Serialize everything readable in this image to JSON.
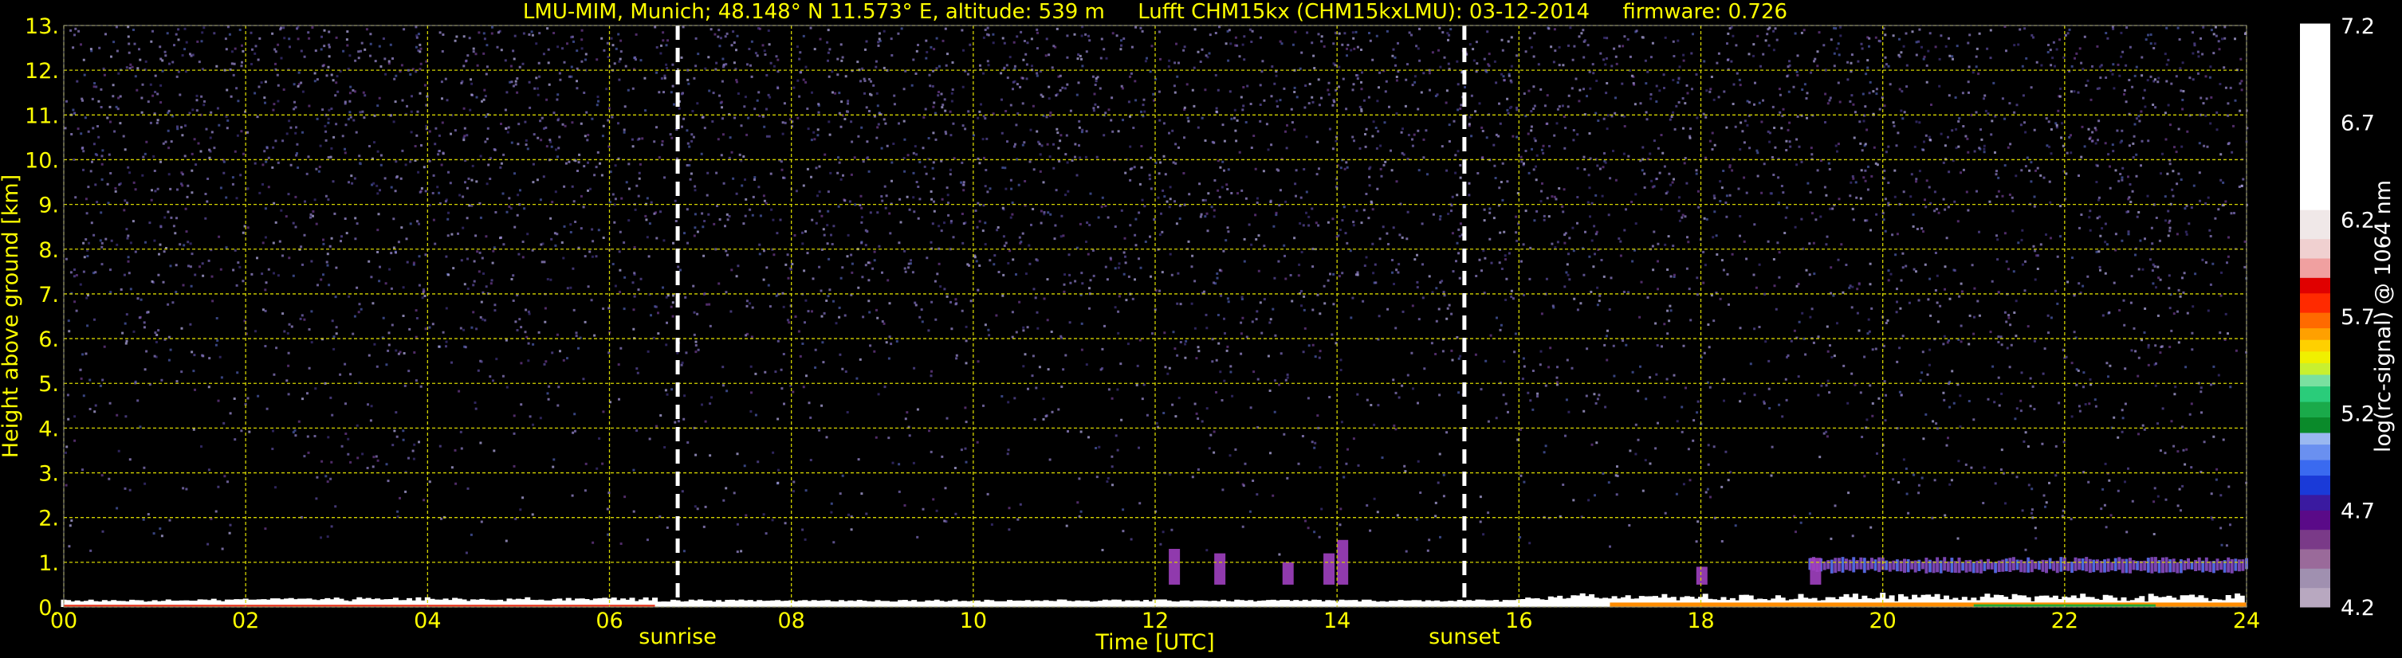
{
  "chart_data": {
    "type": "heatmap",
    "title": "LMU-MIM, Munich; 48.148° N 11.573° E, altitude: 539 m     Lufft CHM15kx (CHM15kxLMU): 03-12-2014     firmware: 0.726",
    "xlabel": "Time [UTC]",
    "ylabel": "Height above ground [km]",
    "colorbar_label": "log(rc-signal) @ 1064 nm",
    "xlim": [
      0,
      24
    ],
    "ylim": [
      0,
      13
    ],
    "x_ticks": [
      0,
      2,
      4,
      6,
      8,
      10,
      12,
      14,
      16,
      18,
      20,
      22,
      24
    ],
    "x_tick_labels": [
      "00",
      "02",
      "04",
      "06",
      "08",
      "10",
      "12",
      "14",
      "16",
      "18",
      "20",
      "22",
      "24"
    ],
    "y_ticks": [
      0,
      1,
      2,
      3,
      4,
      5,
      6,
      7,
      8,
      9,
      10,
      11,
      12,
      13
    ],
    "y_tick_labels": [
      "0.",
      "1.",
      "2.",
      "3.",
      "4.",
      "5.",
      "6.",
      "7.",
      "8.",
      "9.",
      "10.",
      "11.",
      "12.",
      "13."
    ],
    "colorbar_range": [
      4.2,
      7.2
    ],
    "colorbar_ticks": [
      4.2,
      4.7,
      5.2,
      5.7,
      6.2,
      6.7,
      7.2
    ],
    "colorbar_tick_labels": [
      "4.2",
      "4.7",
      "5.2",
      "5.7",
      "6.2",
      "6.7",
      "7.2"
    ],
    "grid": true,
    "markers": [
      {
        "label": "sunrise",
        "time": 6.75
      },
      {
        "label": "sunset",
        "time": 15.4
      }
    ]
  },
  "colors": {
    "background": "#000000",
    "text": "#ffff00",
    "grid": "#d4d400",
    "colorbar_label": "#ffffff"
  }
}
